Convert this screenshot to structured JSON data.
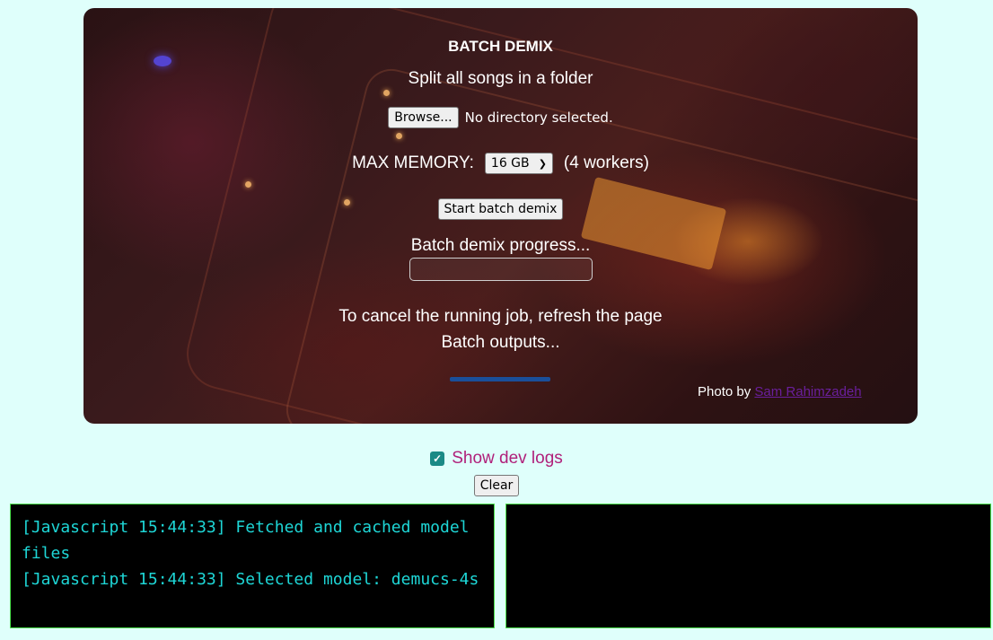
{
  "panel": {
    "title": "BATCH DEMIX",
    "subtitle": "Split all songs in a folder",
    "browse_label": "Browse...",
    "directory_status": "No directory selected.",
    "max_memory_label": "MAX MEMORY:",
    "memory_selected": "16 GB",
    "workers_text": "(4 workers)",
    "start_label": "Start batch demix",
    "progress_label": "Batch demix progress...",
    "progress_percent": 0,
    "cancel_text": "To cancel the running job, refresh the page",
    "outputs_text": "Batch outputs...",
    "photo_by": "Photo by",
    "photo_author": "Sam Rahimzadeh"
  },
  "devlogs": {
    "label": "Show dev logs",
    "checked": true,
    "clear_label": "Clear"
  },
  "logs": {
    "left": [
      "[Javascript 15:44:33] Fetched and cached model files",
      "[Javascript 15:44:33] Selected model: demucs-4s"
    ],
    "right": []
  },
  "colors": {
    "page_bg": "#dffffb",
    "accent_pink": "#b0207a",
    "log_text": "#1ed6d6",
    "log_border": "#4be04b"
  }
}
